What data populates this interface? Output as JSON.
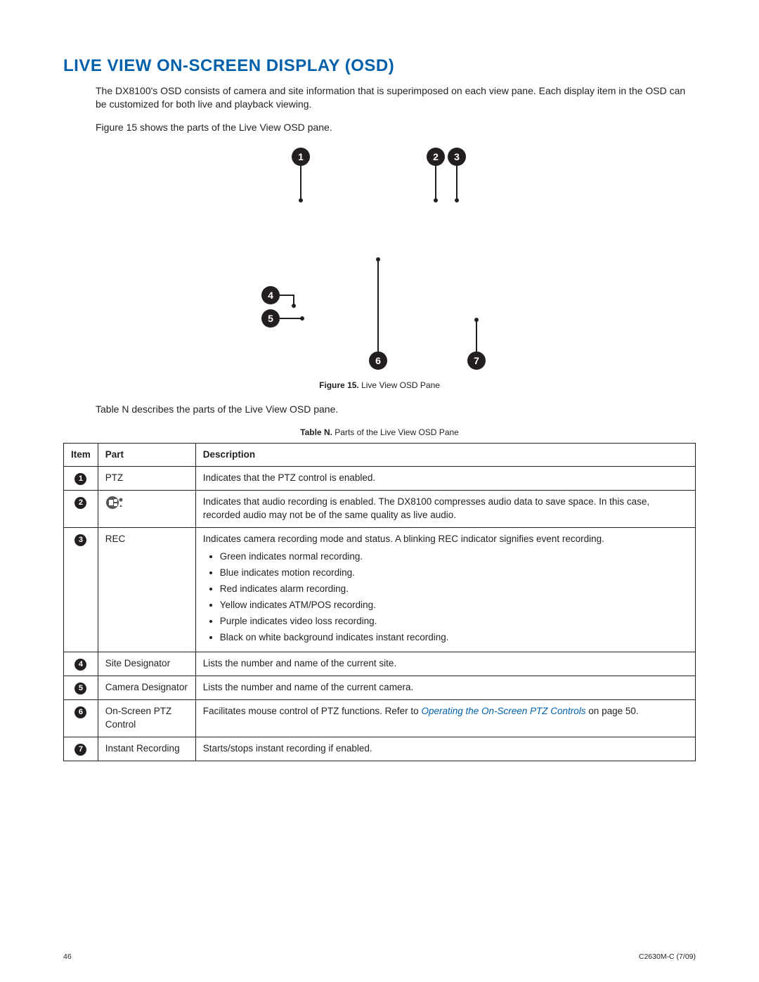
{
  "title": "LIVE VIEW ON-SCREEN DISPLAY (OSD)",
  "intro_paragraph": "The DX8100's OSD consists of camera and site information that is superimposed on each view pane. Each display item in the OSD can be customized for both live and playback viewing.",
  "figure_lead": "Figure 15 shows the parts of the Live View OSD pane.",
  "figure_caption_label": "Figure 15.",
  "figure_caption_text": "Live View OSD Pane",
  "table_lead": "Table N describes the parts of the Live View OSD pane.",
  "table_caption_label": "Table N.",
  "table_caption_text": "Parts of the Live View OSD Pane",
  "table_headers": {
    "item": "Item",
    "part": "Part",
    "desc": "Description"
  },
  "rows": [
    {
      "n": "1",
      "part": "PTZ",
      "desc": "Indicates that the PTZ control is enabled."
    },
    {
      "n": "2",
      "part": "",
      "is_audio_icon": true,
      "desc": "Indicates that audio recording is enabled. The DX8100 compresses audio data to save space. In this case, recorded audio may not be of the same quality as live audio."
    },
    {
      "n": "3",
      "part": "REC",
      "desc": "Indicates camera recording mode and status. A blinking REC indicator signifies event recording.",
      "bullets": [
        "Green indicates normal recording.",
        "Blue indicates motion recording.",
        "Red indicates alarm recording.",
        "Yellow indicates ATM/POS recording.",
        "Purple indicates video loss recording.",
        "Black on white background indicates instant recording."
      ]
    },
    {
      "n": "4",
      "part": "Site Designator",
      "desc": "Lists the number and name of the current site."
    },
    {
      "n": "5",
      "part": "Camera Designator",
      "desc": "Lists the number and name of the current camera."
    },
    {
      "n": "6",
      "part": "On-Screen PTZ Control",
      "desc_prefix": "Facilitates mouse control of PTZ functions. Refer to ",
      "desc_link": "Operating the On-Screen PTZ Controls",
      "desc_suffix": " on page 50."
    },
    {
      "n": "7",
      "part": "Instant Recording",
      "desc": "Starts/stops instant recording if enabled."
    }
  ],
  "callouts": [
    "1",
    "2",
    "3",
    "4",
    "5",
    "6",
    "7"
  ],
  "footer": {
    "left": "46",
    "right": "C2630M-C (7/09)"
  }
}
